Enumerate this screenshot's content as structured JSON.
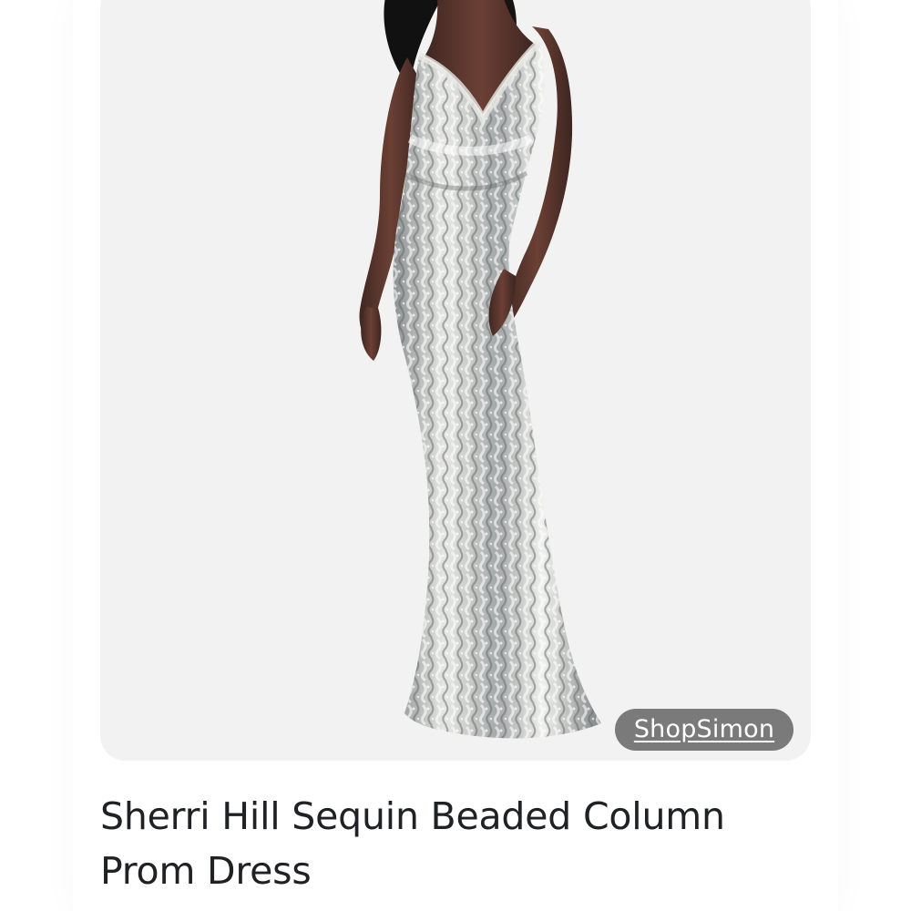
{
  "product": {
    "title": "Sherri Hill Sequin Beaded Column Prom Dress",
    "source": "ShopSimon"
  },
  "colors": {
    "image_background": "#f3f2f3",
    "chip_background": "#5f5f5f",
    "title_text": "#202124"
  },
  "image": {
    "subject": "model wearing silver sequin beaded column gown"
  }
}
